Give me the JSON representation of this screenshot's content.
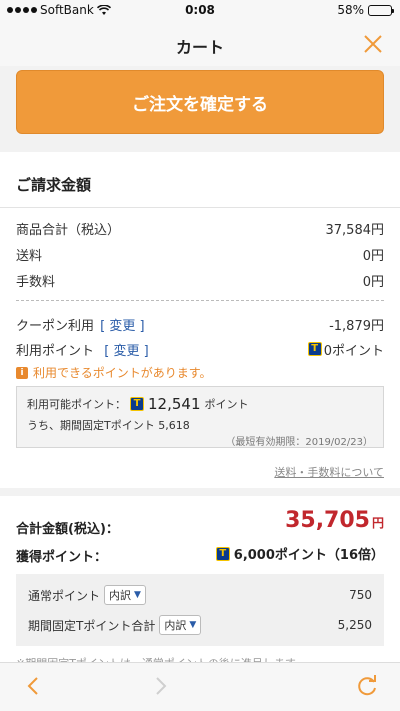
{
  "status_bar": {
    "carrier": "SoftBank",
    "time": "0:08",
    "battery": "58%",
    "battery_level": 0.58
  },
  "nav": {
    "title": "カート"
  },
  "confirm_button": {
    "label": "ご注文を確定する"
  },
  "billing": {
    "heading": "ご請求金額",
    "subtotal_label": "商品合計（税込）",
    "subtotal_value": "37,584円",
    "shipping_label": "送料",
    "shipping_value": "0円",
    "fee_label": "手数料",
    "fee_value": "0円",
    "coupon_label": "クーポン利用",
    "coupon_change": "[ 変更 ]",
    "coupon_value": "-1,879円",
    "points_label": "利用ポイント",
    "points_change": "[ 変更 ]",
    "points_value": "0ポイント",
    "notice": "利用できるポイントがあります。",
    "available_label": "利用可能ポイント：",
    "available_value": "12,541",
    "available_unit": "ポイント",
    "fixed_points_text": "うち、期間固定Tポイント 5,618",
    "expiry_text": "（最短有効期限：2019/02/23）",
    "shipping_link": "送料・手数料について",
    "total_label": "合計金額(税込)：",
    "total_value": "35,705",
    "total_unit": "円",
    "earn_label": "獲得ポイント：",
    "earn_value": "6,000ポイント（16倍）",
    "normal_points_label": "通常ポイント",
    "normal_points_select": "内訳",
    "normal_points_value": "750",
    "fixed_total_label": "期間固定Tポイント合計",
    "fixed_total_select": "内訳",
    "fixed_total_value": "5,250",
    "cutoff_text": "※期間固定Tポイントは、通常ポイントの後に進呈します。"
  },
  "icons": {
    "close": "close-icon",
    "back": "chevron-left-icon",
    "forward": "chevron-right-icon",
    "reload": "reload-icon",
    "tpoint": "t-point-icon",
    "info": "info-icon"
  },
  "colors": {
    "accent": "#f09a3a",
    "total": "#c1272d",
    "link": "#2a5ca8",
    "notice": "#e8892e"
  }
}
